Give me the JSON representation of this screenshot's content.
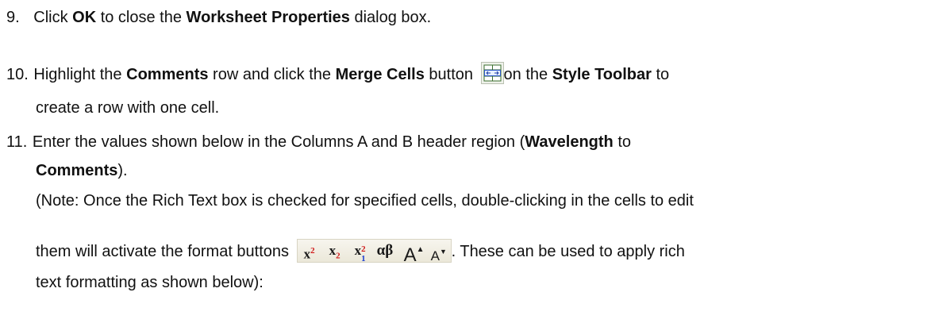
{
  "steps": [
    {
      "number": "9.",
      "text_before": "Click ",
      "bold_1": "OK",
      "text_mid": " to close the ",
      "bold_2": "Worksheet Properties",
      "text_after": " dialog box."
    },
    {
      "number": "10.",
      "t1": "Highlight the ",
      "b1": "Comments",
      "t2": " row and click the ",
      "b2": "Merge Cells",
      "t3": " button ",
      "t4": "on the ",
      "b3": "Style Toolbar",
      "t5": " to",
      "line2": "create a row with one cell."
    },
    {
      "number": "11.",
      "t1": "Enter the values shown below in the Columns A and B header region (",
      "b1": "Wavelength",
      "t2": " to",
      "b2": "Comments",
      "t3": ").",
      "note_line1": "(Note: Once the Rich Text box is checked for specified cells, double-clicking in the cells to edit",
      "note_t1": "them will activate the format buttons ",
      "note_t2": ". These can be used to apply rich",
      "note_line3": "text formatting as shown below):"
    }
  ],
  "format_buttons": {
    "superscript": {
      "base": "x",
      "script": "2",
      "icon": "superscript-icon"
    },
    "subscript": {
      "base": "x",
      "script": "2",
      "icon": "subscript-icon"
    },
    "supersub": {
      "base": "x",
      "sup": "2",
      "sub": "1",
      "icon": "supersubscript-icon"
    },
    "greek": {
      "label": "αβ",
      "icon": "greek-icon"
    },
    "increase_font": {
      "label": "A",
      "icon": "increase-font-icon"
    },
    "decrease_font": {
      "label": "A",
      "icon": "decrease-font-icon"
    }
  },
  "icons": {
    "merge_cells": "merge-cells-icon"
  }
}
